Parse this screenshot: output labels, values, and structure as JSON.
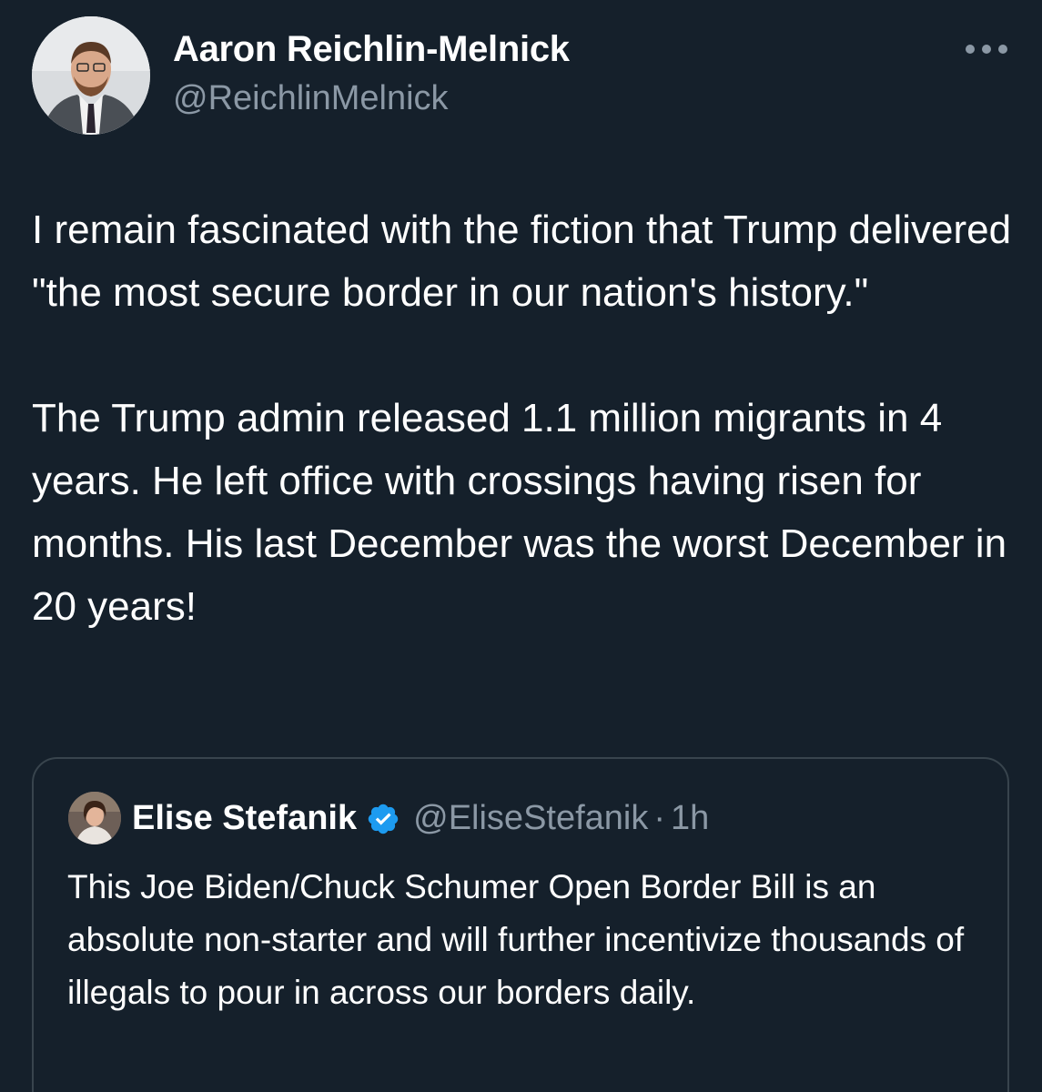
{
  "author": {
    "name": "Aaron Reichlin-Melnick",
    "handle": "@ReichlinMelnick"
  },
  "tweet": {
    "text": "I remain fascinated with the fiction that Trump delivered \"the most secure border in our nation's history.\"\n\nThe Trump admin released 1.1 million migrants in 4 years. He left office with crossings having risen for months. His last December was the worst December in 20 years!"
  },
  "quoted_tweet": {
    "name": "Elise Stefanik",
    "handle": "@EliseStefanik",
    "separator": "·",
    "time": "1h",
    "text": "This Joe Biden/Chuck Schumer Open Border Bill is an absolute non-starter and will further incentivize thousands of illegals to pour in across our borders daily."
  },
  "icons": {
    "more": "more-horizontal-icon",
    "verified": "verified-badge-icon"
  },
  "colors": {
    "background": "#15202b",
    "text_primary": "#ffffff",
    "text_secondary": "#8b98a5",
    "border": "#38444d",
    "verified_blue": "#1d9bf0"
  }
}
